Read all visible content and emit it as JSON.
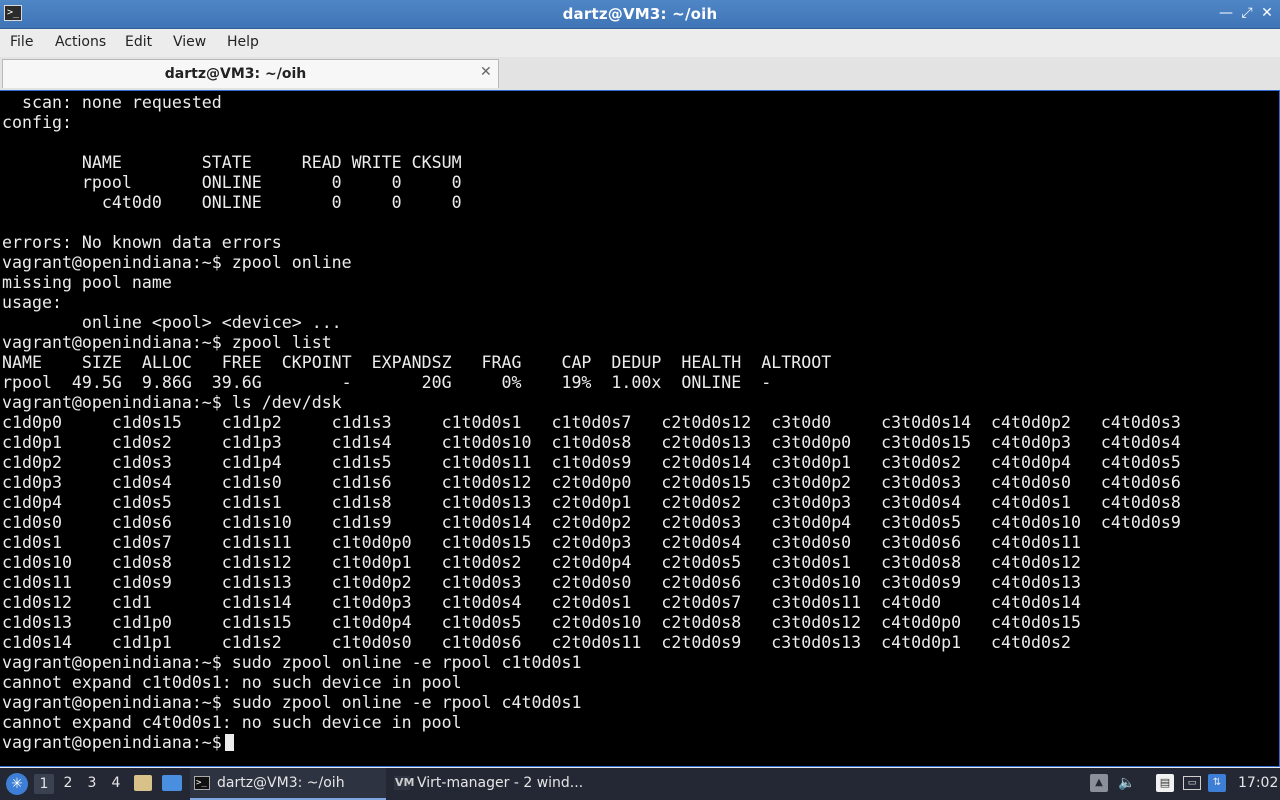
{
  "window": {
    "title": "dartz@VM3: ~/oih",
    "icon_glyph": ">_",
    "controls": {
      "minimize": "—",
      "maximize": "⤢",
      "close": "✕"
    }
  },
  "menubar": {
    "file": "File",
    "actions": "Actions",
    "edit": "Edit",
    "view": "View",
    "help": "Help"
  },
  "tab": {
    "label": "dartz@VM3: ~/oih",
    "close": "✕"
  },
  "terminal": {
    "lines": [
      "  scan: none requested",
      "config:",
      "",
      "        NAME        STATE     READ WRITE CKSUM",
      "        rpool       ONLINE       0     0     0",
      "          c4t0d0    ONLINE       0     0     0",
      "",
      "errors: No known data errors",
      "vagrant@openindiana:~$ zpool online",
      "missing pool name",
      "usage:",
      "        online <pool> <device> ...",
      "vagrant@openindiana:~$ zpool list",
      "NAME    SIZE  ALLOC   FREE  CKPOINT  EXPANDSZ   FRAG    CAP  DEDUP  HEALTH  ALTROOT",
      "rpool  49.5G  9.86G  39.6G        -       20G     0%    19%  1.00x  ONLINE  -",
      "vagrant@openindiana:~$ ls /dev/dsk",
      "c1d0p0     c1d0s15    c1d1p2     c1d1s3     c1t0d0s1   c1t0d0s7   c2t0d0s12  c3t0d0     c3t0d0s14  c4t0d0p2   c4t0d0s3",
      "c1d0p1     c1d0s2     c1d1p3     c1d1s4     c1t0d0s10  c1t0d0s8   c2t0d0s13  c3t0d0p0   c3t0d0s15  c4t0d0p3   c4t0d0s4",
      "c1d0p2     c1d0s3     c1d1p4     c1d1s5     c1t0d0s11  c1t0d0s9   c2t0d0s14  c3t0d0p1   c3t0d0s2   c4t0d0p4   c4t0d0s5",
      "c1d0p3     c1d0s4     c1d1s0     c1d1s6     c1t0d0s12  c2t0d0p0   c2t0d0s15  c3t0d0p2   c3t0d0s3   c4t0d0s0   c4t0d0s6",
      "c1d0p4     c1d0s5     c1d1s1     c1d1s8     c1t0d0s13  c2t0d0p1   c2t0d0s2   c3t0d0p3   c3t0d0s4   c4t0d0s1   c4t0d0s8",
      "c1d0s0     c1d0s6     c1d1s10    c1d1s9     c1t0d0s14  c2t0d0p2   c2t0d0s3   c3t0d0p4   c3t0d0s5   c4t0d0s10  c4t0d0s9",
      "c1d0s1     c1d0s7     c1d1s11    c1t0d0p0   c1t0d0s15  c2t0d0p3   c2t0d0s4   c3t0d0s0   c3t0d0s6   c4t0d0s11",
      "c1d0s10    c1d0s8     c1d1s12    c1t0d0p1   c1t0d0s2   c2t0d0p4   c2t0d0s5   c3t0d0s1   c3t0d0s8   c4t0d0s12",
      "c1d0s11    c1d0s9     c1d1s13    c1t0d0p2   c1t0d0s3   c2t0d0s0   c2t0d0s6   c3t0d0s10  c3t0d0s9   c4t0d0s13",
      "c1d0s12    c1d1       c1d1s14    c1t0d0p3   c1t0d0s4   c2t0d0s1   c2t0d0s7   c3t0d0s11  c4t0d0     c4t0d0s14",
      "c1d0s13    c1d1p0     c1d1s15    c1t0d0p4   c1t0d0s5   c2t0d0s10  c2t0d0s8   c3t0d0s12  c4t0d0p0   c4t0d0s15",
      "c1d0s14    c1d1p1     c1d1s2     c1t0d0s0   c1t0d0s6   c2t0d0s11  c2t0d0s9   c3t0d0s13  c4t0d0p1   c4t0d0s2",
      "vagrant@openindiana:~$ sudo zpool online -e rpool c1t0d0s1",
      "cannot expand c1t0d0s1: no such device in pool",
      "vagrant@openindiana:~$ sudo zpool online -e rpool c4t0d0s1",
      "cannot expand c4t0d0s1: no such device in pool"
    ],
    "prompt": "vagrant@openindiana:~$ "
  },
  "taskbar": {
    "start_glyph": "✳",
    "workspaces": [
      "1",
      "2",
      "3",
      "4"
    ],
    "tasks": [
      {
        "label": "dartz@VM3: ~/oih",
        "icon": ">_"
      },
      {
        "label": "Virt-manager - 2 wind...",
        "icon": "VM"
      }
    ],
    "tray": {
      "up": "▲",
      "volume": "🔈",
      "clipboard": "▤",
      "display": "▭",
      "network": "⇅"
    },
    "clock": "17:02"
  }
}
